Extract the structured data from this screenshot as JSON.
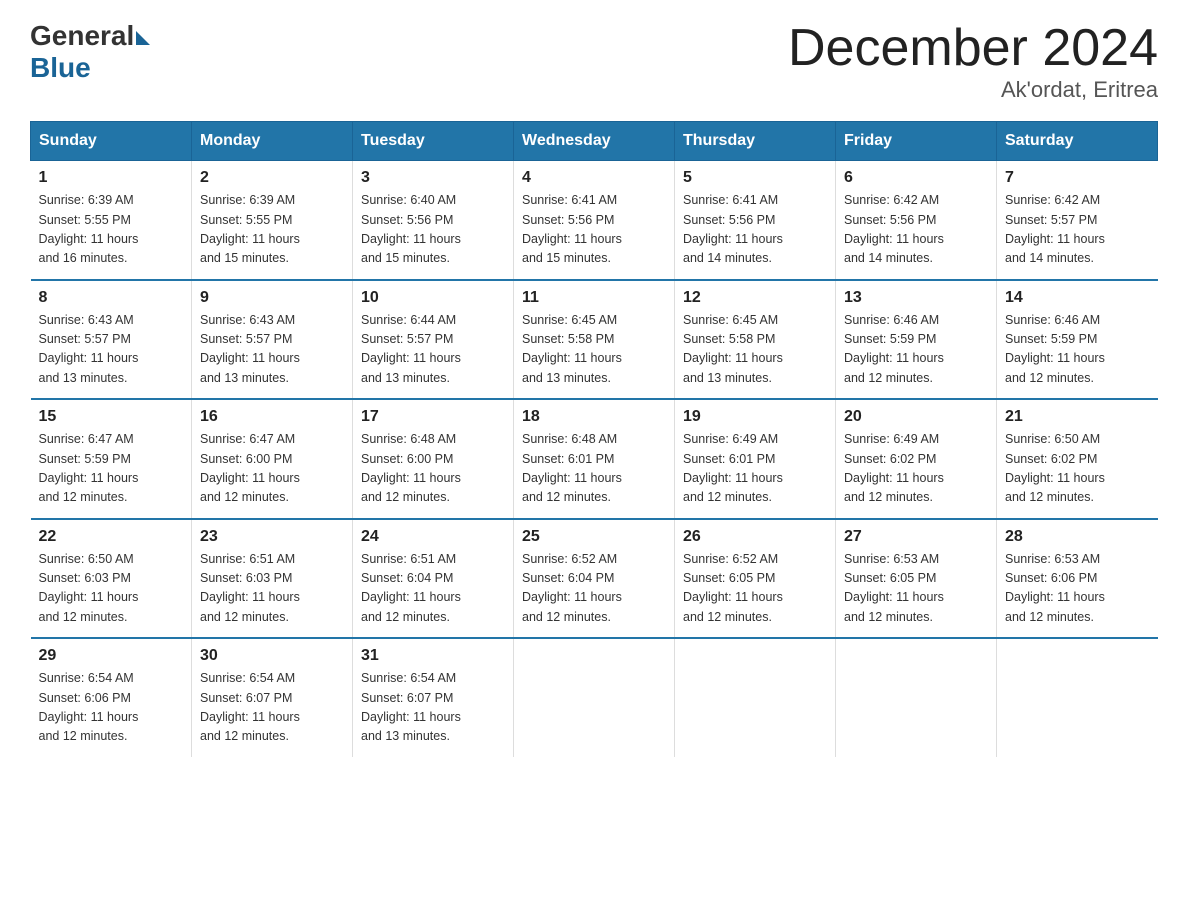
{
  "logo": {
    "general": "General",
    "blue": "Blue"
  },
  "header": {
    "month": "December 2024",
    "location": "Ak'ordat, Eritrea"
  },
  "days_of_week": [
    "Sunday",
    "Monday",
    "Tuesday",
    "Wednesday",
    "Thursday",
    "Friday",
    "Saturday"
  ],
  "weeks": [
    [
      {
        "day": "1",
        "sunrise": "6:39 AM",
        "sunset": "5:55 PM",
        "daylight": "11 hours and 16 minutes."
      },
      {
        "day": "2",
        "sunrise": "6:39 AM",
        "sunset": "5:55 PM",
        "daylight": "11 hours and 15 minutes."
      },
      {
        "day": "3",
        "sunrise": "6:40 AM",
        "sunset": "5:56 PM",
        "daylight": "11 hours and 15 minutes."
      },
      {
        "day": "4",
        "sunrise": "6:41 AM",
        "sunset": "5:56 PM",
        "daylight": "11 hours and 15 minutes."
      },
      {
        "day": "5",
        "sunrise": "6:41 AM",
        "sunset": "5:56 PM",
        "daylight": "11 hours and 14 minutes."
      },
      {
        "day": "6",
        "sunrise": "6:42 AM",
        "sunset": "5:56 PM",
        "daylight": "11 hours and 14 minutes."
      },
      {
        "day": "7",
        "sunrise": "6:42 AM",
        "sunset": "5:57 PM",
        "daylight": "11 hours and 14 minutes."
      }
    ],
    [
      {
        "day": "8",
        "sunrise": "6:43 AM",
        "sunset": "5:57 PM",
        "daylight": "11 hours and 13 minutes."
      },
      {
        "day": "9",
        "sunrise": "6:43 AM",
        "sunset": "5:57 PM",
        "daylight": "11 hours and 13 minutes."
      },
      {
        "day": "10",
        "sunrise": "6:44 AM",
        "sunset": "5:57 PM",
        "daylight": "11 hours and 13 minutes."
      },
      {
        "day": "11",
        "sunrise": "6:45 AM",
        "sunset": "5:58 PM",
        "daylight": "11 hours and 13 minutes."
      },
      {
        "day": "12",
        "sunrise": "6:45 AM",
        "sunset": "5:58 PM",
        "daylight": "11 hours and 13 minutes."
      },
      {
        "day": "13",
        "sunrise": "6:46 AM",
        "sunset": "5:59 PM",
        "daylight": "11 hours and 12 minutes."
      },
      {
        "day": "14",
        "sunrise": "6:46 AM",
        "sunset": "5:59 PM",
        "daylight": "11 hours and 12 minutes."
      }
    ],
    [
      {
        "day": "15",
        "sunrise": "6:47 AM",
        "sunset": "5:59 PM",
        "daylight": "11 hours and 12 minutes."
      },
      {
        "day": "16",
        "sunrise": "6:47 AM",
        "sunset": "6:00 PM",
        "daylight": "11 hours and 12 minutes."
      },
      {
        "day": "17",
        "sunrise": "6:48 AM",
        "sunset": "6:00 PM",
        "daylight": "11 hours and 12 minutes."
      },
      {
        "day": "18",
        "sunrise": "6:48 AM",
        "sunset": "6:01 PM",
        "daylight": "11 hours and 12 minutes."
      },
      {
        "day": "19",
        "sunrise": "6:49 AM",
        "sunset": "6:01 PM",
        "daylight": "11 hours and 12 minutes."
      },
      {
        "day": "20",
        "sunrise": "6:49 AM",
        "sunset": "6:02 PM",
        "daylight": "11 hours and 12 minutes."
      },
      {
        "day": "21",
        "sunrise": "6:50 AM",
        "sunset": "6:02 PM",
        "daylight": "11 hours and 12 minutes."
      }
    ],
    [
      {
        "day": "22",
        "sunrise": "6:50 AM",
        "sunset": "6:03 PM",
        "daylight": "11 hours and 12 minutes."
      },
      {
        "day": "23",
        "sunrise": "6:51 AM",
        "sunset": "6:03 PM",
        "daylight": "11 hours and 12 minutes."
      },
      {
        "day": "24",
        "sunrise": "6:51 AM",
        "sunset": "6:04 PM",
        "daylight": "11 hours and 12 minutes."
      },
      {
        "day": "25",
        "sunrise": "6:52 AM",
        "sunset": "6:04 PM",
        "daylight": "11 hours and 12 minutes."
      },
      {
        "day": "26",
        "sunrise": "6:52 AM",
        "sunset": "6:05 PM",
        "daylight": "11 hours and 12 minutes."
      },
      {
        "day": "27",
        "sunrise": "6:53 AM",
        "sunset": "6:05 PM",
        "daylight": "11 hours and 12 minutes."
      },
      {
        "day": "28",
        "sunrise": "6:53 AM",
        "sunset": "6:06 PM",
        "daylight": "11 hours and 12 minutes."
      }
    ],
    [
      {
        "day": "29",
        "sunrise": "6:54 AM",
        "sunset": "6:06 PM",
        "daylight": "11 hours and 12 minutes."
      },
      {
        "day": "30",
        "sunrise": "6:54 AM",
        "sunset": "6:07 PM",
        "daylight": "11 hours and 12 minutes."
      },
      {
        "day": "31",
        "sunrise": "6:54 AM",
        "sunset": "6:07 PM",
        "daylight": "11 hours and 13 minutes."
      },
      null,
      null,
      null,
      null
    ]
  ],
  "labels": {
    "sunrise": "Sunrise:",
    "sunset": "Sunset:",
    "daylight": "Daylight:"
  }
}
